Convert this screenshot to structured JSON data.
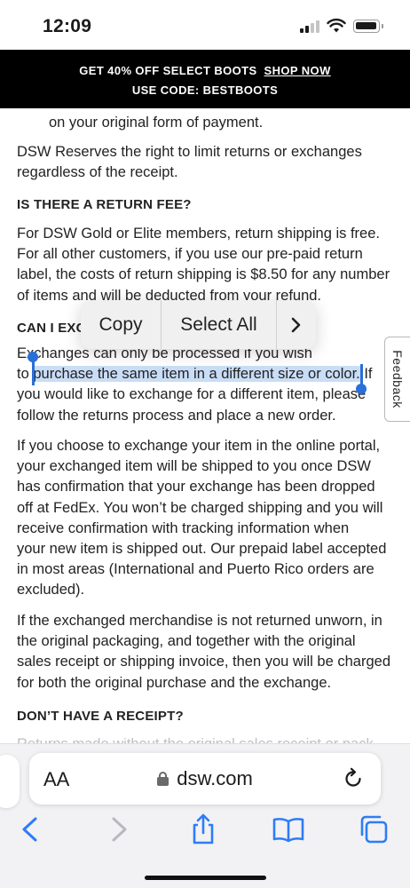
{
  "status_bar": {
    "time": "12:09",
    "battery_level": 0.85
  },
  "promo": {
    "text": "GET 40% OFF SELECT BOOTS",
    "link": "SHOP NOW",
    "code_line": "USE CODE:  BESTBOOTS"
  },
  "article": {
    "lines": {
      "l1": "on your original form of payment.",
      "l2": "DSW Reserves the right to limit returns or exchanges",
      "l3": "regardless of the receipt.",
      "h_fee": "IS THERE A RETURN FEE?",
      "l4": "For DSW Gold or Elite members, return shipping is free.",
      "l5": "For all other customers, if you use our pre-paid return",
      "l6": "label, the costs of return shipping is $8.50 for any number",
      "l7": "of items and will be deducted from your refund.",
      "h_exchange": "CAN I EXC",
      "l8": "Exchanges can only be processed if you wish",
      "l9_pre": "to ",
      "l9_sel": "purchase the same item in a different size or color.",
      "l9_post": " If",
      "l10": "you would like to exchange for a different item, please",
      "l11": "follow the returns process and place a new order.",
      "l12": "If you choose to exchange your item in the online portal,",
      "l13": "your exchanged item will be shipped to you once DSW",
      "l14": "has confirmation that your exchange has been dropped",
      "l15": "off at FedEx. You won’t be charged shipping and you will",
      "l16": "receive confirmation with tracking information when",
      "l17": "your new item is shipped out. Our prepaid label accepted",
      "l18": "in most areas (International and Puerto Rico orders are",
      "l19": "excluded).",
      "l20": "If the exchanged merchandise is not returned unworn, in",
      "l21": "the original packaging, and together with the original",
      "l22": "sales receipt or shipping invoice, then you will be charged",
      "l23": "for both the original purchase and the exchange.",
      "h_receipt": "DON’T HAVE A RECEIPT?",
      "l24": "Returns made without the original sales receipt or pack"
    }
  },
  "edit_menu": {
    "copy": "Copy",
    "select_all": "Select All",
    "more": "›"
  },
  "feedback": {
    "label": "Feedback"
  },
  "browser": {
    "text_size": "AA",
    "url": "dsw.com"
  }
}
